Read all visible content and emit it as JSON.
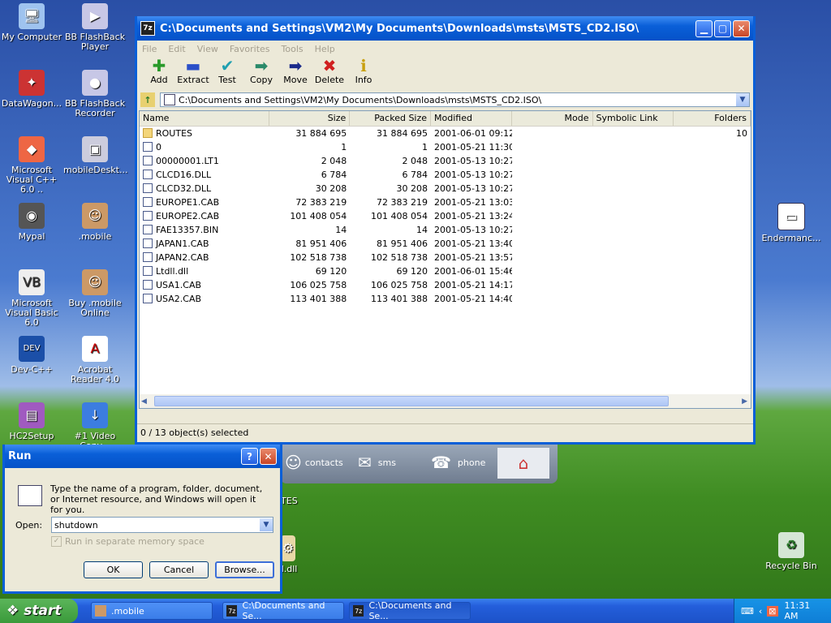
{
  "desktop": {
    "icons": [
      {
        "label": "My Computer"
      },
      {
        "label": "BB FlashBack Player"
      },
      {
        "label": "DataWagon..."
      },
      {
        "label": "BB FlashBack Recorder"
      },
      {
        "label": "Microsoft Visual C++ 6.0 .."
      },
      {
        "label": "mobileDeskt..."
      },
      {
        "label": "Mypal"
      },
      {
        "label": ".mobile"
      },
      {
        "label": "Microsoft Visual Basic 6.0"
      },
      {
        "label": "Buy .mobile Online"
      },
      {
        "label": "Dev-C++"
      },
      {
        "label": "Acrobat Reader 4.0"
      },
      {
        "label": "HC2Setup"
      },
      {
        "label": "#1 Video Conv..."
      },
      {
        "label": "Endermanc..."
      },
      {
        "label": "Recycle Bin"
      },
      {
        "label": "OUTES"
      },
      {
        "label": "ll.dll"
      }
    ],
    "mobile_bar": {
      "contacts": "contacts",
      "sms": "sms",
      "phone": "phone"
    }
  },
  "explorer": {
    "title": "C:\\Documents and Settings\\VM2\\My Documents\\Downloads\\msts\\MSTS_CD2.ISO\\",
    "app_icon": "7z",
    "menu": [
      "File",
      "Edit",
      "View",
      "Favorites",
      "Tools",
      "Help"
    ],
    "toolbar": [
      "Add",
      "Extract",
      "Test",
      "Copy",
      "Move",
      "Delete",
      "Info"
    ],
    "address": "C:\\Documents and Settings\\VM2\\My Documents\\Downloads\\msts\\MSTS_CD2.ISO\\",
    "columns": [
      "Name",
      "Size",
      "Packed Size",
      "Modified",
      "Mode",
      "Symbolic Link",
      "Folders"
    ],
    "rows": [
      {
        "name": "ROUTES",
        "size": "31 884 695",
        "packed": "31 884 695",
        "modified": "2001-06-01 09:12",
        "folders": "10",
        "icon": "folder"
      },
      {
        "name": "0",
        "size": "1",
        "packed": "1",
        "modified": "2001-05-21 11:30",
        "folders": "",
        "icon": "file"
      },
      {
        "name": "00000001.LT1",
        "size": "2 048",
        "packed": "2 048",
        "modified": "2001-05-13 10:27",
        "folders": "",
        "icon": "file"
      },
      {
        "name": "CLCD16.DLL",
        "size": "6 784",
        "packed": "6 784",
        "modified": "2001-05-13 10:27",
        "folders": "",
        "icon": "dll"
      },
      {
        "name": "CLCD32.DLL",
        "size": "30 208",
        "packed": "30 208",
        "modified": "2001-05-13 10:27",
        "folders": "",
        "icon": "dll"
      },
      {
        "name": "EUROPE1.CAB",
        "size": "72 383 219",
        "packed": "72 383 219",
        "modified": "2001-05-21 13:03",
        "folders": "",
        "icon": "cab"
      },
      {
        "name": "EUROPE2.CAB",
        "size": "101 408 054",
        "packed": "101 408 054",
        "modified": "2001-05-21 13:24",
        "folders": "",
        "icon": "cab"
      },
      {
        "name": "FAE13357.BIN",
        "size": "14",
        "packed": "14",
        "modified": "2001-05-13 10:27",
        "folders": "",
        "icon": "file"
      },
      {
        "name": "JAPAN1.CAB",
        "size": "81 951 406",
        "packed": "81 951 406",
        "modified": "2001-05-21 13:40",
        "folders": "",
        "icon": "cab"
      },
      {
        "name": "JAPAN2.CAB",
        "size": "102 518 738",
        "packed": "102 518 738",
        "modified": "2001-05-21 13:57",
        "folders": "",
        "icon": "cab"
      },
      {
        "name": "Ltdll.dll",
        "size": "69 120",
        "packed": "69 120",
        "modified": "2001-06-01 15:46",
        "folders": "",
        "icon": "dll"
      },
      {
        "name": "USA1.CAB",
        "size": "106 025 758",
        "packed": "106 025 758",
        "modified": "2001-05-21 14:17",
        "folders": "",
        "icon": "cab"
      },
      {
        "name": "USA2.CAB",
        "size": "113 401 388",
        "packed": "113 401 388",
        "modified": "2001-05-21 14:40",
        "folders": "",
        "icon": "cab"
      }
    ],
    "status": "0 / 13 object(s) selected"
  },
  "run": {
    "title": "Run",
    "description": "Type the name of a program, folder, document, or Internet resource, and Windows will open it for you.",
    "open_label": "Open:",
    "open_value": "shutdown",
    "checkbox_label": "Run in separate memory space",
    "ok": "OK",
    "cancel": "Cancel",
    "browse": "Browse..."
  },
  "taskbar": {
    "start": "start",
    "tasks": [
      ".mobile",
      "C:\\Documents and Se...",
      "C:\\Documents and Se..."
    ],
    "clock": "11:31 AM"
  }
}
